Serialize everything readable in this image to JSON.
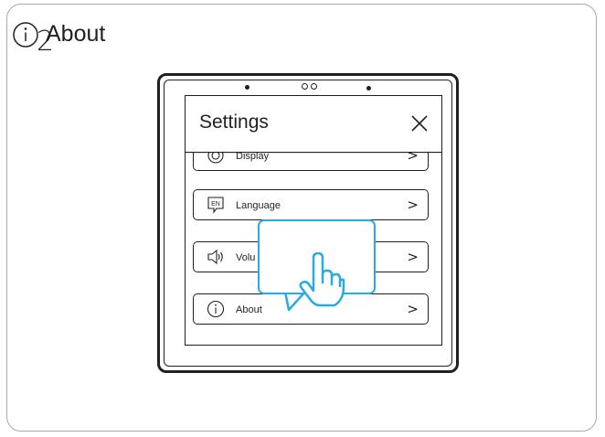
{
  "step_number": "2",
  "screen": {
    "title": "Settings",
    "close_icon": "close-x-icon",
    "items": [
      {
        "label": "Display",
        "icon": "display-icon"
      },
      {
        "label": "Language",
        "icon": "language-icon",
        "icon_text": "EN"
      },
      {
        "label": "Volu",
        "icon": "speaker-icon"
      },
      {
        "label": "About",
        "icon": "info-icon"
      }
    ],
    "chevron": ">"
  },
  "callout": {
    "label": "About",
    "icon": "info-icon",
    "pointer": "tap-hand-icon"
  },
  "colors": {
    "callout_border": "#29abe2",
    "line": "#231f20",
    "frame_border": "#a7a9ac"
  }
}
